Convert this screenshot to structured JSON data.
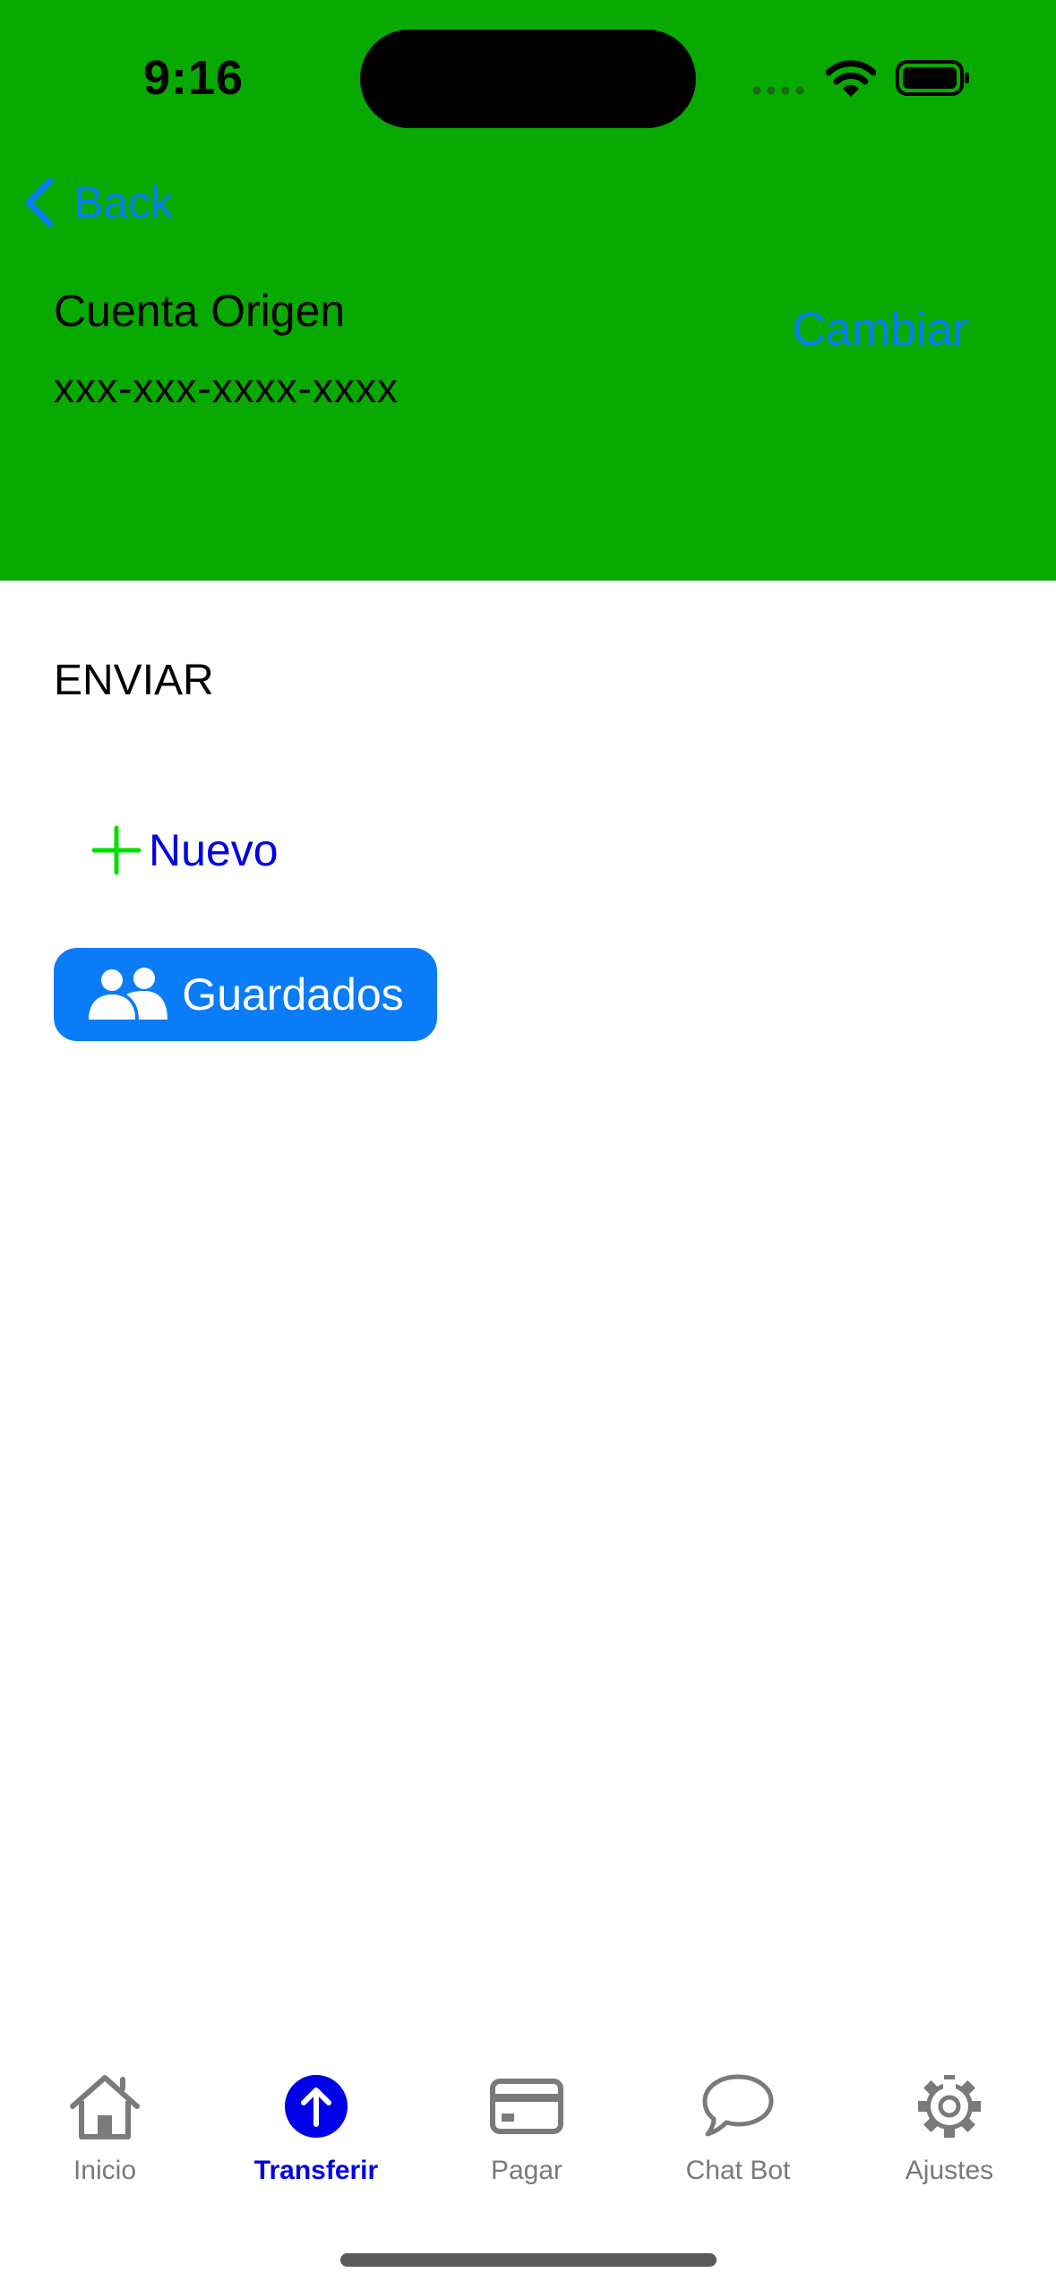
{
  "status_bar": {
    "time": "9:16"
  },
  "nav": {
    "back_label": "Back"
  },
  "account": {
    "title": "Cuenta Origen",
    "number": "xxx-xxx-xxxx-xxxx",
    "change_label": "Cambiar"
  },
  "send": {
    "section_title": "ENVIAR",
    "new_label": "Nuevo",
    "saved_label": "Guardados"
  },
  "tabs": [
    {
      "label": "Inicio",
      "icon": "house-icon",
      "active": false
    },
    {
      "label": "Transferir",
      "icon": "arrow-up-circle-icon",
      "active": true
    },
    {
      "label": "Pagar",
      "icon": "credit-card-icon",
      "active": false
    },
    {
      "label": "Chat Bot",
      "icon": "chat-bubble-icon",
      "active": false
    },
    {
      "label": "Ajustes",
      "icon": "gear-icon",
      "active": false
    }
  ],
  "colors": {
    "header_bg": "#08A900",
    "accent": "#0A7CF7",
    "active_tab": "#0000E6",
    "plus_icon": "#00E000"
  }
}
